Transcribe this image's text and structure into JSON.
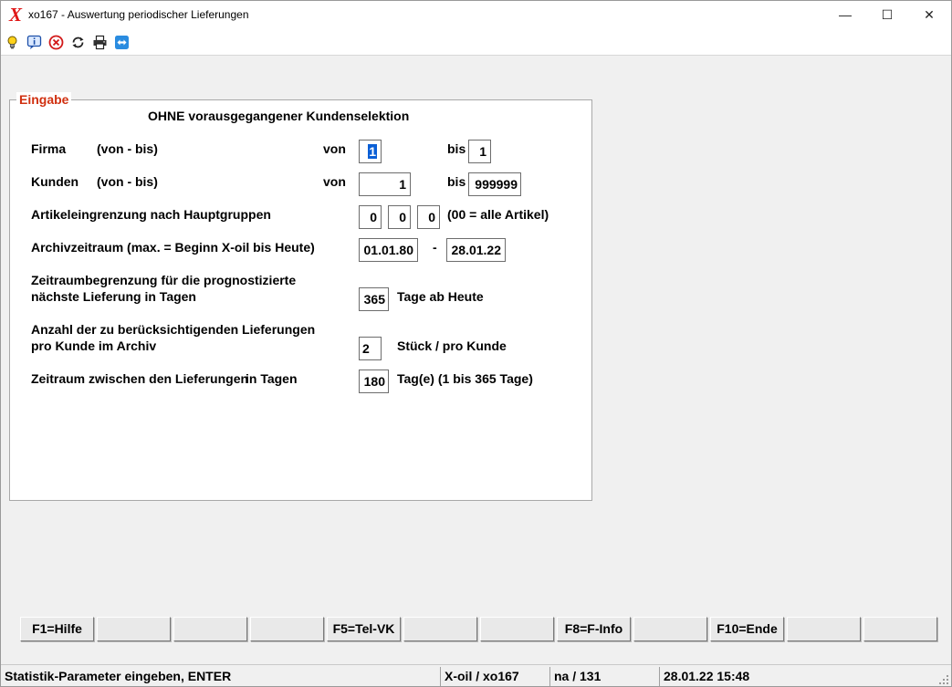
{
  "window": {
    "title": "xo167 - Auswertung periodischer Lieferungen",
    "logo": "X",
    "controls": {
      "minimize": "—",
      "maximize": "☐",
      "close": "✕"
    }
  },
  "toolbar": {
    "icons": [
      "lightbulb-icon",
      "info-icon",
      "cancel-icon",
      "refresh-icon",
      "printer-icon",
      "remote-support-icon"
    ]
  },
  "form": {
    "group_title": "Eingabe",
    "heading": "OHNE vorausgegangener Kundenselektion",
    "firma": {
      "label": "Firma",
      "range_hint": "(von - bis)",
      "von_label": "von",
      "von_value": "1",
      "bis_label": "bis",
      "bis_value": "1"
    },
    "kunden": {
      "label": "Kunden",
      "range_hint": "(von - bis)",
      "von_label": "von",
      "von_value": "1",
      "bis_label": "bis",
      "bis_value": "999999"
    },
    "artikel": {
      "label": "Artikeleingrenzung nach Hauptgruppen",
      "values": [
        "0",
        "0",
        "0"
      ],
      "hint": "(00 = alle Artikel)"
    },
    "archiv": {
      "label": "Archivzeitraum (max. = Beginn X-oil bis Heute)",
      "from": "01.01.80",
      "sep": "-",
      "to": "28.01.22"
    },
    "zeitraum_prog": {
      "label_line1": "Zeitraumbegrenzung für die prognostizierte",
      "label_line2": "nächste Lieferung in Tagen",
      "value": "365",
      "suffix": "Tage ab Heute"
    },
    "anzahl": {
      "label_line1": "Anzahl der zu berücksichtigenden Lieferungen",
      "label_line2": "pro Kunde im Archiv",
      "value": "2",
      "suffix": "Stück / pro Kunde"
    },
    "zwischen": {
      "label_part1": "Zeitraum zwischen den Lieferungen",
      "label_part2": "in Tagen",
      "value": "180",
      "suffix": "Tag(e) (1 bis 365 Tage)"
    }
  },
  "fkeys": [
    "F1=Hilfe",
    "",
    "",
    "",
    "F5=Tel-VK",
    "",
    "",
    "F8=F-Info",
    "",
    "F10=Ende",
    "",
    ""
  ],
  "status": {
    "message": "Statistik-Parameter eingeben, ENTER",
    "program": "X-oil / xo167",
    "user": "na / 131",
    "datetime": "28.01.22 15:48"
  },
  "colors": {
    "logo": "#e01515",
    "legend": "#d03010",
    "selection": "#0a5fd6"
  }
}
